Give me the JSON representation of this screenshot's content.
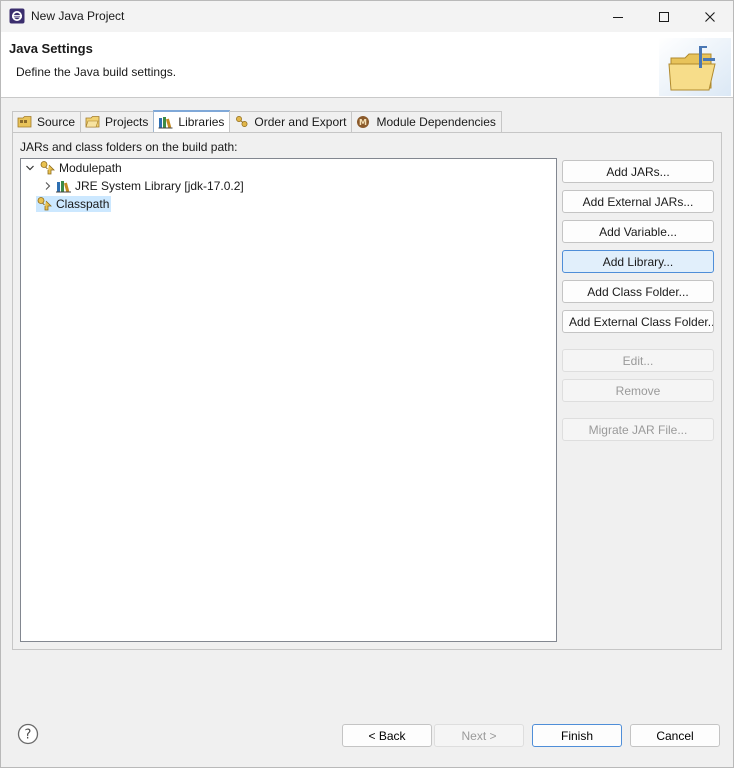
{
  "window": {
    "title": "New Java Project"
  },
  "banner": {
    "title": "Java Settings",
    "description": "Define the Java build settings."
  },
  "tabs": [
    {
      "label": "Source",
      "icon": "source-folder-icon",
      "active": false
    },
    {
      "label": "Projects",
      "icon": "projects-icon",
      "active": false
    },
    {
      "label": "Libraries",
      "icon": "libraries-icon",
      "active": true
    },
    {
      "label": "Order and Export",
      "icon": "order-export-icon",
      "active": false
    },
    {
      "label": "Module Dependencies",
      "icon": "module-icon",
      "active": false
    }
  ],
  "libraries": {
    "label": "JARs and class folders on the build path:",
    "tree": [
      {
        "label": "Modulepath",
        "expanded": true,
        "icon": "classpath-icon"
      },
      {
        "label": "JRE System Library [jdk-17.0.2]",
        "expanded": false,
        "icon": "library-icon"
      },
      {
        "label": "Classpath",
        "selected": true,
        "icon": "classpath-icon"
      }
    ],
    "buttons": [
      {
        "label": "Add JARs...",
        "enabled": true
      },
      {
        "label": "Add External JARs...",
        "enabled": true
      },
      {
        "label": "Add Variable...",
        "enabled": true
      },
      {
        "label": "Add Library...",
        "enabled": true,
        "focused": true
      },
      {
        "label": "Add Class Folder...",
        "enabled": true
      },
      {
        "label": "Add External Class Folder...",
        "enabled": true
      },
      {
        "label": "Edit...",
        "enabled": false
      },
      {
        "label": "Remove",
        "enabled": false
      },
      {
        "label": "Migrate JAR File...",
        "enabled": false
      }
    ]
  },
  "footer": {
    "back": "< Back",
    "next": "Next >",
    "finish": "Finish",
    "cancel": "Cancel"
  },
  "colors": {
    "accent": "#4f8ed8",
    "selection": "#cce8ff"
  }
}
